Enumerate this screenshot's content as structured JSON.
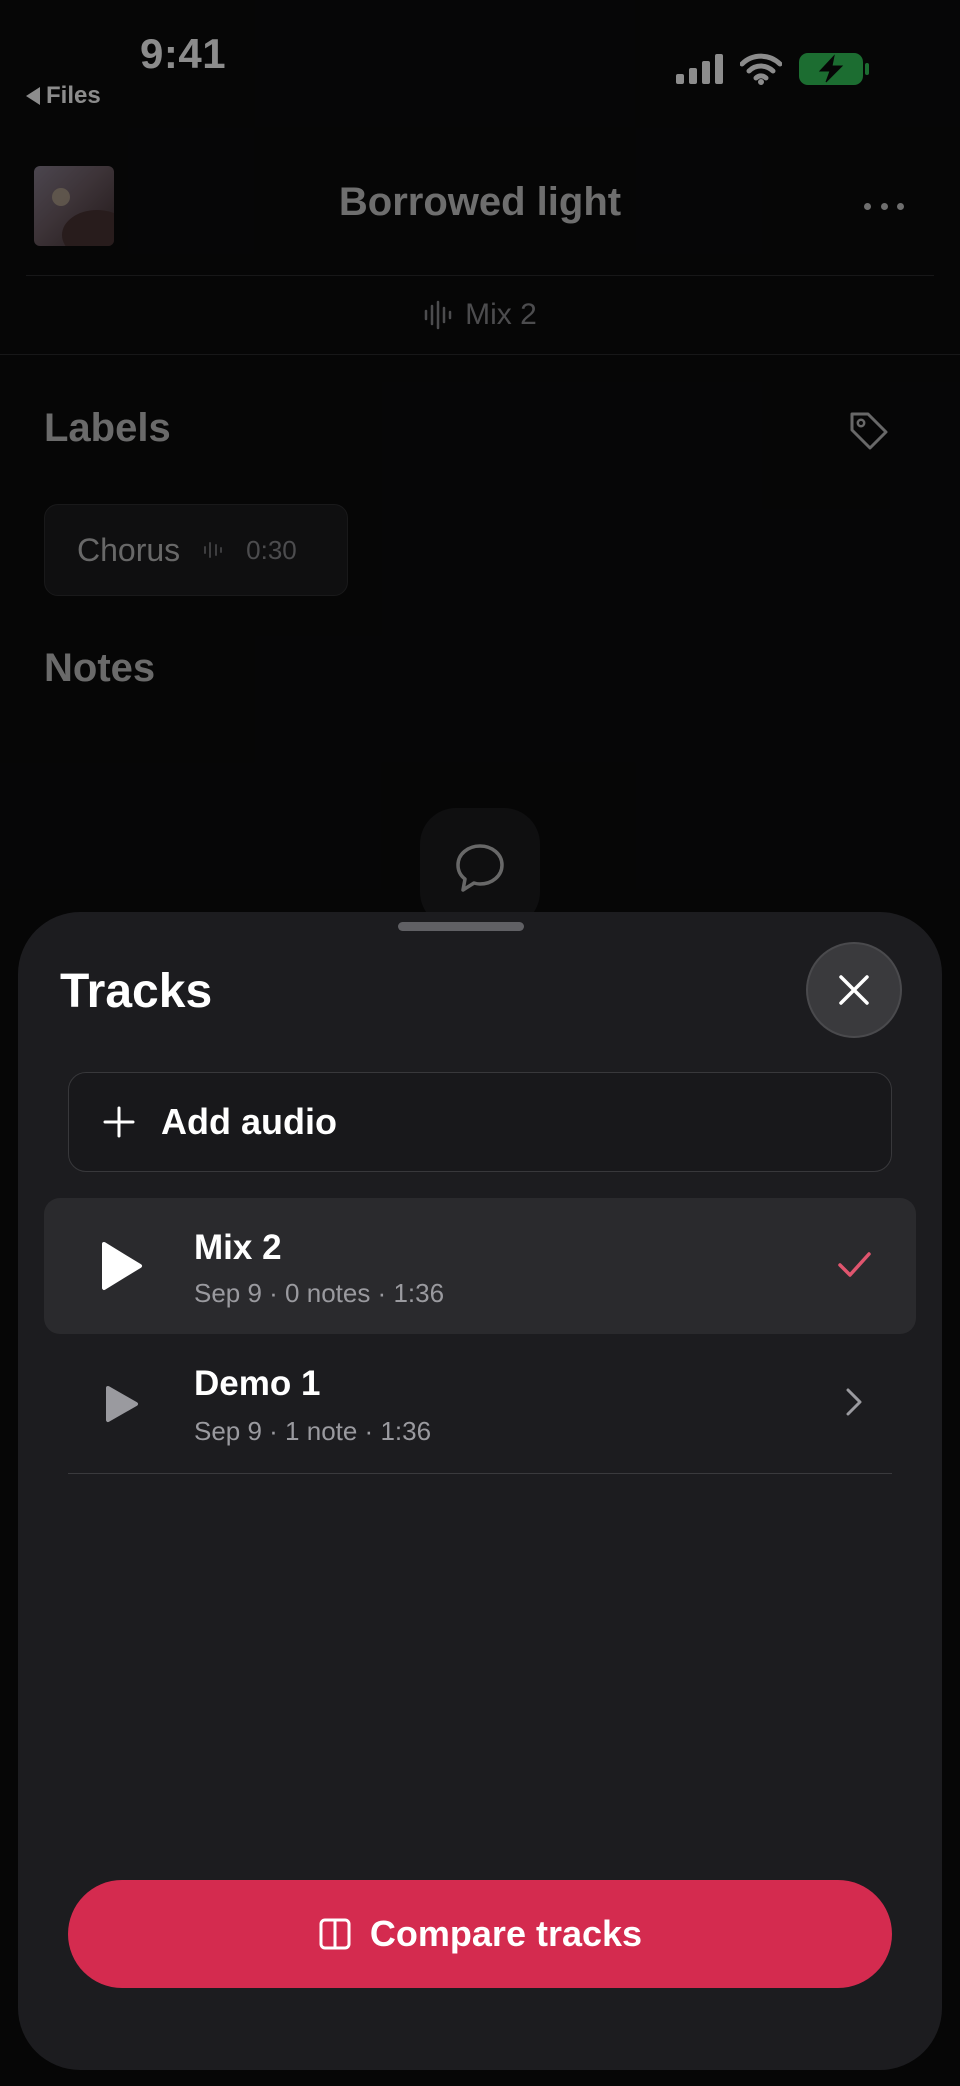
{
  "status_bar": {
    "time": "9:41",
    "back_label": "Files"
  },
  "header": {
    "title": "Borrowed light",
    "current_mix": "Mix 2"
  },
  "labels": {
    "title": "Labels",
    "items": [
      {
        "name": "Chorus",
        "time": "0:30"
      }
    ]
  },
  "notes": {
    "title": "Notes"
  },
  "sheet": {
    "title": "Tracks",
    "add_audio_label": "Add audio",
    "tracks": [
      {
        "name": "Mix 2",
        "meta": "Sep 9 · 0 notes · 1:36",
        "selected": true
      },
      {
        "name": "Demo 1",
        "meta": "Sep 9 · 1 note · 1:36",
        "selected": false
      }
    ],
    "compare_label": "Compare tracks"
  },
  "colors": {
    "accent": "#d42b4f",
    "battery": "#34c759",
    "check": "#e0556e"
  }
}
